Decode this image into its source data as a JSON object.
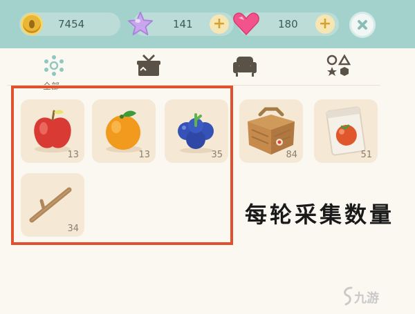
{
  "currencies": {
    "coins": "7454",
    "stars": "141",
    "hearts": "180"
  },
  "tabs": {
    "active_label": "全部"
  },
  "items": [
    {
      "name": "apple",
      "count": "13"
    },
    {
      "name": "orange",
      "count": "13"
    },
    {
      "name": "blueberry",
      "count": "35"
    },
    {
      "name": "picnic-basket",
      "count": "84"
    },
    {
      "name": "seed-packet",
      "count": "51"
    },
    {
      "name": "branch",
      "count": "34"
    }
  ],
  "caption": "每轮采集数量",
  "watermark": "九游",
  "colors": {
    "topbar": "#a3d1cc",
    "highlight": "#e0522f",
    "slot": "#f5e9d6"
  }
}
